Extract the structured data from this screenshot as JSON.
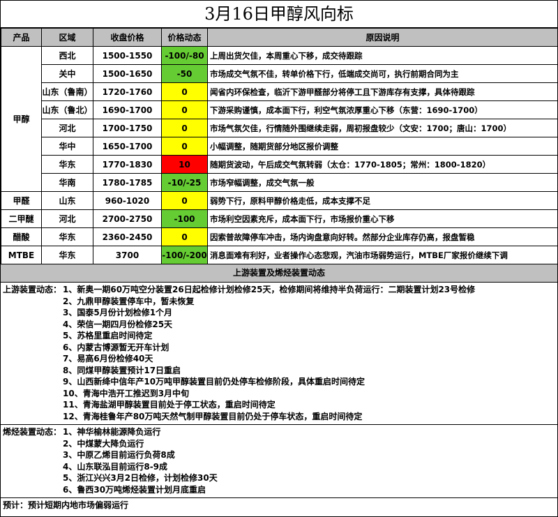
{
  "title": "3月16日甲醇风向标",
  "table": {
    "headers": [
      "产品",
      "区域",
      "收盘价格",
      "价格动态",
      "原因说明"
    ],
    "groups": [
      {
        "product": "甲醇",
        "rows": [
          {
            "region": "西北",
            "price": "1500-1550",
            "change": "-100/-80",
            "color": "green",
            "reason": "上周出货欠佳，本周重心下移，成交待跟踪"
          },
          {
            "region": "关中",
            "price": "1500-1650",
            "change": "-50",
            "color": "green",
            "reason": "市场成交气氛不佳，转单价格下行，低端成交尚可，执行前期合同为主"
          },
          {
            "region": "山东（鲁南）",
            "price": "1720-1760",
            "change": "0",
            "color": "yellow",
            "reason": "闻省内环保检查，临沂下游甲醛部分将停工且下游库存有支撑，具体待跟踪"
          },
          {
            "region": "山东（鲁北）",
            "price": "1690-1700",
            "change": "0",
            "color": "yellow",
            "reason": "下游采购谨慎，成本面下行，利空气氛浓厚重心下移（东营：1690-1700）"
          },
          {
            "region": "河北",
            "price": "1700-1750",
            "change": "0",
            "color": "yellow",
            "reason": "市场气氛欠佳，行情随外围继续走弱，周初报盘较少（文安：1700；唐山：1700）"
          },
          {
            "region": "华中",
            "price": "1650-1700",
            "change": "0",
            "color": "yellow",
            "reason": "小幅调整，随期货部分地区报价调整"
          },
          {
            "region": "华东",
            "price": "1770-1830",
            "change": "10",
            "color": "red",
            "reason": "随期货波动，午后成交气氛转弱（太仓：1770-1805；常州：1800-1820）"
          },
          {
            "region": "华南",
            "price": "1780-1785",
            "change": "-10/-25",
            "color": "green",
            "reason": "市场窄幅调整，成交气氛一般"
          }
        ]
      },
      {
        "product": "甲醛",
        "rows": [
          {
            "region": "山东",
            "price": "960-1020",
            "change": "0",
            "color": "yellow",
            "reason": "弱势下行，原料甲醇价格走低，成本支撑不足"
          }
        ]
      },
      {
        "product": "二甲醚",
        "rows": [
          {
            "region": "河北",
            "price": "2700-2750",
            "change": "-100",
            "color": "green",
            "reason": "市场利空因素充斥，成本面下行，市场报价重心下移"
          }
        ]
      },
      {
        "product": "醋酸",
        "rows": [
          {
            "region": "华东",
            "price": "2360-2450",
            "change": "0",
            "color": "yellow",
            "reason": "因索普故障停车冲击，场内询盘意向好转。然部分企业库存仍高，报盘暂稳"
          }
        ]
      },
      {
        "product": "MTBE",
        "rows": [
          {
            "region": "华东",
            "price": "3700",
            "change": "-100/-200",
            "color": "green",
            "reason": "消息面难有利好，业者操作心态悲观，汽油市场弱势运行，MTBE厂家报价继续下调"
          }
        ]
      }
    ]
  },
  "section_title": "上游装置及烯烃装置动态",
  "upstream": {
    "label": "上游装置动态：",
    "items": [
      "1、新奥一期60万吨空分装置26日起检修计划检修25天，检修期间将维持半负荷运行：二期装置计划23号检修",
      "2、九鼎甲醇装置停车中，暂未恢复",
      "3、国泰5月份计划检修1个月",
      "4、荣信一期四月份检修25天",
      "5、苏格里重启时间待定",
      "6、内蒙古博源暂无开车计划",
      "7、易高6月份检修40天",
      "8、同煤甲醇装置预计17日重启",
      "9、山西新绛中信年产10万吨甲醇装置目前仍处停车检修阶段，具体重启时间待定",
      "10、青海中浩开工推迟到3月中旬",
      "11、青海盐湖甲醇装置目前处于停工状态，重启时间待定",
      "12、青海桂鲁年产80万吨天然气制甲醇装置目前仍处于停车状态，重启时间待定"
    ]
  },
  "olefin": {
    "label": "烯烃装置动态：",
    "items": [
      "1、神华榆林能源降负运行",
      "2、中煤蒙大降负运行",
      "3、中原乙烯目前运行负荷8成",
      "4、山东联泓目前运行8-9成",
      "5、浙江兴兴3月2日检修，计划检修30天",
      "6、鲁西30万吨烯烃装置计划月底重启"
    ]
  },
  "forecast": "预计：预计短期内地市场偏弱运行"
}
